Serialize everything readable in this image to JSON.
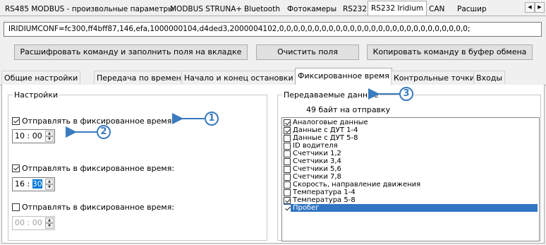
{
  "top_tabs": [
    "RS485 MODBUS - произвольные параметры",
    "MODBUS STRUNA+",
    "Bluetooth",
    "Фотокамеры",
    "RS232",
    "RS232 Iridium",
    "CAN",
    "Расшир"
  ],
  "command": "IRIDIUMCONF=fc300,ff4bff87,146,efa,1000000104,d4ded3,2000004102,0,0,0,0,0,0,0,0,0,0,0,0,0,0,0,0,0,0,0,0,0,0,0,0,0,0,0;",
  "buttons": {
    "decode": "Расшифровать команду и заполнить поля на вкладке",
    "clear": "Очистить поля",
    "copy": "Копировать команду в буфер обмена"
  },
  "inner_tabs": [
    "Общие настройки",
    "Передача по времени",
    "Начало и конец остановки",
    "Фиксированное время",
    "Контрольные точки",
    "Входы"
  ],
  "settings": {
    "title": "Настройки",
    "rows": [
      {
        "label": "Отправлять в фиксированное время:",
        "checked": true,
        "hh": "10",
        "mm": "00"
      },
      {
        "label": "Отправлять в фиксированное время:",
        "checked": true,
        "hh": "16",
        "mm": "30"
      },
      {
        "label": "Отправлять в фиксированное время:",
        "checked": false,
        "hh": "00",
        "mm": "00"
      }
    ]
  },
  "transmitted": {
    "title": "Передаваемые данные",
    "bytes": "49 байт на отправку",
    "items": [
      {
        "label": "Аналоговые данные",
        "checked": true
      },
      {
        "label": "Данные с ДУТ 1-4",
        "checked": true
      },
      {
        "label": "Данные с ДУТ 5-8",
        "checked": false
      },
      {
        "label": "ID водителя",
        "checked": false
      },
      {
        "label": "Счетчики 1,2",
        "checked": false
      },
      {
        "label": "Счетчики 3,4",
        "checked": false
      },
      {
        "label": "Счетчики 5,6",
        "checked": false
      },
      {
        "label": "Счетчики 7,8",
        "checked": false
      },
      {
        "label": "Скорость, направление движения",
        "checked": false
      },
      {
        "label": "Температура 1-4",
        "checked": false
      },
      {
        "label": "Температура 5-8",
        "checked": true
      },
      {
        "label": "Пробег",
        "checked": true
      }
    ]
  },
  "callouts": [
    "1",
    "2",
    "3"
  ],
  "colors": {
    "accent": "#3a7bbf",
    "selection": "#3175c3"
  }
}
